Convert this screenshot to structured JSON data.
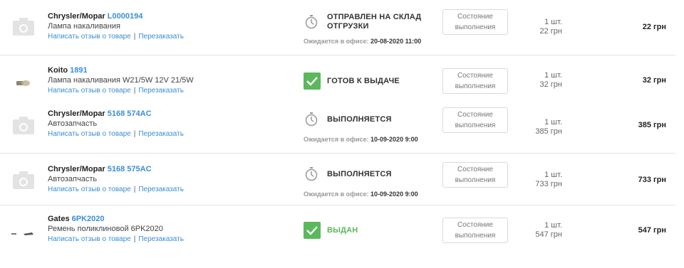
{
  "items": [
    {
      "brand": "Chrysler/Mopar",
      "code": "L0000194",
      "description": "Лампа накаливания",
      "review_link": "Написать отзыв о товаре",
      "reorder_link": "Перезаказать",
      "image": "camera-placeholder-icon",
      "status_icon": "stopwatch-icon",
      "status_line1": "ОТПРАВЛЕН НА СКЛАД",
      "status_line2": "ОТГРУЗКИ",
      "expected_label": "Ожидается в офисе:",
      "expected_value": "20-08-2020 11:00",
      "state_button_line1": "Состояние",
      "state_button_line2": "выполнения",
      "qty": "1 шт.",
      "unit_price": "22 грн",
      "total": "22 грн"
    },
    {
      "brand": "Koito",
      "code": "1891",
      "description": "Лампа накаливания W21/5W 12V 21/5W",
      "review_link": "Написать отзыв о товаре",
      "reorder_link": "Перезаказать",
      "image": "bulb-photo",
      "status_icon": "green-check-icon",
      "status_line1": "ГОТОВ К ВЫДАЧЕ",
      "status_line2": "",
      "state_button_line1": "Состояние",
      "state_button_line2": "выполнения",
      "qty": "1 шт.",
      "unit_price": "32 грн",
      "total": "32 грн"
    },
    {
      "brand": "Chrysler/Mopar",
      "code": "5168 574AC",
      "description": "Автозапчасть",
      "review_link": "Написать отзыв о товаре",
      "reorder_link": "Перезаказать",
      "image": "camera-placeholder-icon",
      "status_icon": "stopwatch-icon",
      "status_line1": "ВЫПОЛНЯЕТСЯ",
      "status_line2": "",
      "expected_label": "Ожидается в офисе:",
      "expected_value": "10-09-2020 9:00",
      "state_button_line1": "Состояние",
      "state_button_line2": "выполнения",
      "qty": "1 шт.",
      "unit_price": "385 грн",
      "total": "385 грн"
    },
    {
      "brand": "Chrysler/Mopar",
      "code": "5168 575AC",
      "description": "Автозапчасть",
      "review_link": "Написать отзыв о товаре",
      "reorder_link": "Перезаказать",
      "image": "camera-placeholder-icon",
      "status_icon": "stopwatch-icon",
      "status_line1": "ВЫПОЛНЯЕТСЯ",
      "status_line2": "",
      "expected_label": "Ожидается в офисе:",
      "expected_value": "10-09-2020 9:00",
      "state_button_line1": "Состояние",
      "state_button_line2": "выполнения",
      "qty": "1 шт.",
      "unit_price": "733 грн",
      "total": "733 грн"
    },
    {
      "brand": "Gates",
      "code": "6PK2020",
      "description": "Ремень поликлиновой 6PK2020",
      "review_link": "Написать отзыв о товаре",
      "reorder_link": "Перезаказать",
      "image": "belt-photo",
      "status_icon": "green-check-icon",
      "status_line1": "ВЫДАН",
      "status_line2": "",
      "state_button_line1": "Состояние",
      "state_button_line2": "выполнения",
      "qty": "1 шт.",
      "unit_price": "547 грн",
      "total": "547 грн"
    }
  ],
  "colors": {
    "link": "#3b8ed4",
    "ready_green": "#5cb85c",
    "separator": "#e4e4e4"
  }
}
